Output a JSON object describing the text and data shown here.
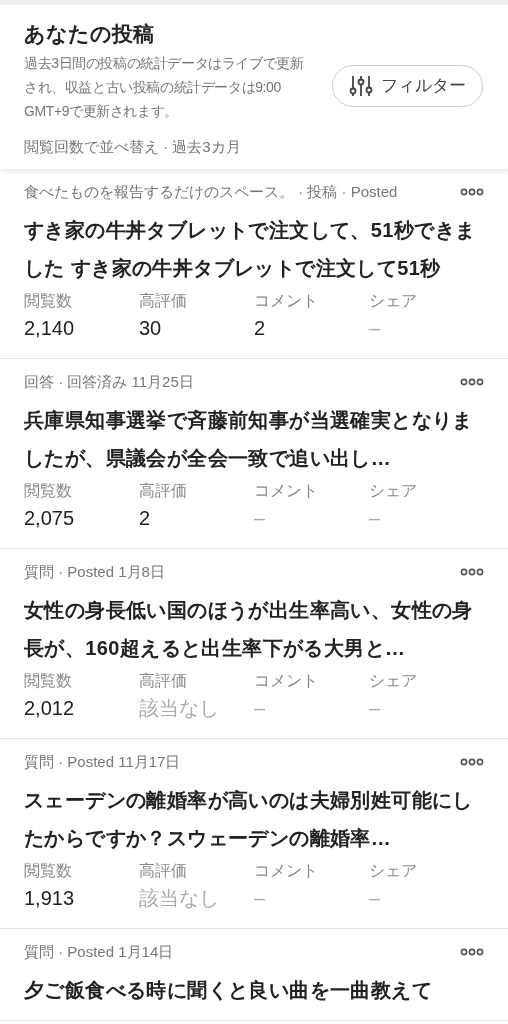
{
  "header": {
    "title": "あなたの投稿",
    "description": "過去3日間の投稿の統計データはライブで更新され、収益と古い投稿の統計データは9:00 GMT+9で更新されます。",
    "filter_button": "フィルター",
    "sort_label": "閲覧回数で並べ替え · 過去3カ月"
  },
  "posts": [
    {
      "meta": "食べたものを報告するだけのスペース。 · 投稿 · Posted",
      "title": "すき家の牛丼タブレットで注文して、51秒できました すき家の牛丼タブレットで注文して51秒",
      "stats": [
        {
          "label": "閲覧数",
          "value": "2,140",
          "muted": false
        },
        {
          "label": "高評価",
          "value": "30",
          "muted": false
        },
        {
          "label": "コメント",
          "value": "2",
          "muted": false
        },
        {
          "label": "シェア",
          "value": "–",
          "muted": true
        }
      ]
    },
    {
      "meta": "回答 · 回答済み 11月25日",
      "title": "兵庫県知事選挙で斉藤前知事が当選確実となりましたが、県議会が全会一致で追い出し…",
      "stats": [
        {
          "label": "閲覧数",
          "value": "2,075",
          "muted": false
        },
        {
          "label": "高評価",
          "value": "2",
          "muted": false
        },
        {
          "label": "コメント",
          "value": "–",
          "muted": true
        },
        {
          "label": "シェア",
          "value": "–",
          "muted": true
        }
      ]
    },
    {
      "meta": "質問 · Posted 1月8日",
      "title": "女性の身長低い国のほうが出生率高い、女性の身長が、160超えると出生率下がる大男と…",
      "stats": [
        {
          "label": "閲覧数",
          "value": "2,012",
          "muted": false
        },
        {
          "label": "高評価",
          "value": "該当なし",
          "muted": true
        },
        {
          "label": "コメント",
          "value": "–",
          "muted": true
        },
        {
          "label": "シェア",
          "value": "–",
          "muted": true
        }
      ]
    },
    {
      "meta": "質問 · Posted 11月17日",
      "title": "スェーデンの離婚率が高いのは夫婦別姓可能にしたからですか？スウェーデンの離婚率…",
      "stats": [
        {
          "label": "閲覧数",
          "value": "1,913",
          "muted": false
        },
        {
          "label": "高評価",
          "value": "該当なし",
          "muted": true
        },
        {
          "label": "コメント",
          "value": "–",
          "muted": true
        },
        {
          "label": "シェア",
          "value": "–",
          "muted": true
        }
      ]
    },
    {
      "meta": "質問 · Posted 1月14日",
      "title": "夕ご飯食べる時に聞くと良い曲を一曲教えて"
    }
  ]
}
